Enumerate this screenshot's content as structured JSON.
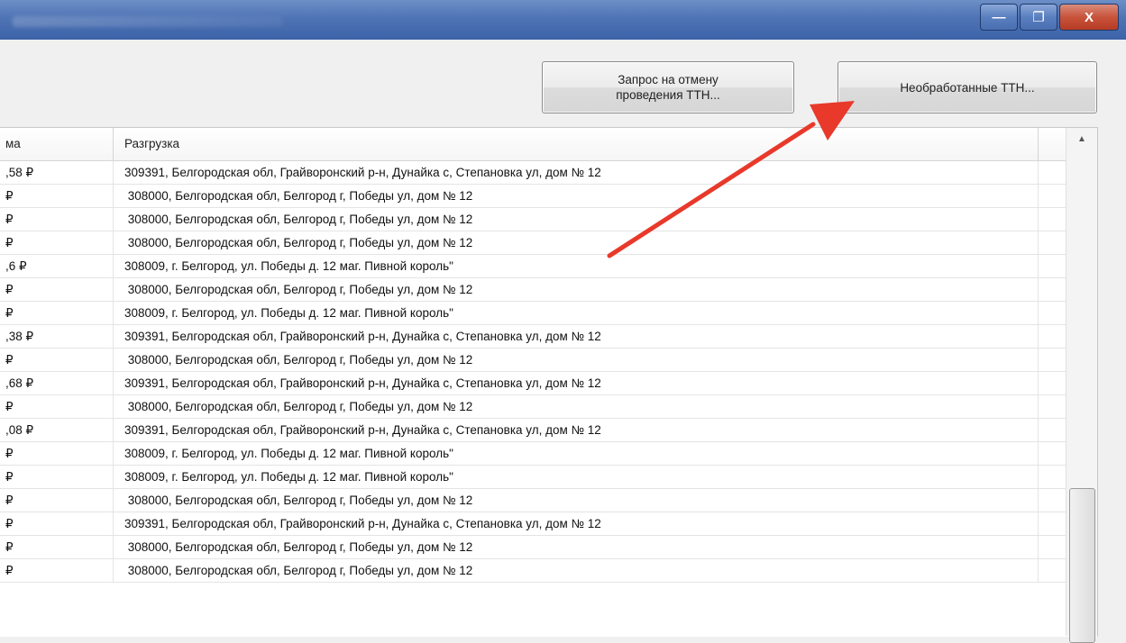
{
  "window": {
    "minimize_glyph": "—",
    "restore_glyph": "❐",
    "close_glyph": "X"
  },
  "toolbar": {
    "cancel_request_line1": "Запрос на отмену",
    "cancel_request_line2": "проведения ТТН...",
    "unprocessed_label": "Необработанные ТТН..."
  },
  "table": {
    "columns": [
      "ма",
      "Разгрузка"
    ],
    "rows": [
      {
        "sum": ",58 ₽",
        "address": "309391, Белгородская обл, Грайворонский р-н, Дунайка с, Степановка ул, дом № 12"
      },
      {
        "sum": " ₽",
        "address": " 308000, Белгородская обл, Белгород г, Победы ул, дом № 12"
      },
      {
        "sum": " ₽",
        "address": " 308000, Белгородская обл, Белгород г, Победы ул, дом № 12"
      },
      {
        "sum": " ₽",
        "address": " 308000, Белгородская обл, Белгород г, Победы ул, дом № 12"
      },
      {
        "sum": ",6 ₽",
        "address": "308009, г. Белгород, ул. Победы д. 12 маг. Пивной король\""
      },
      {
        "sum": " ₽",
        "address": " 308000, Белгородская обл, Белгород г, Победы ул, дом № 12"
      },
      {
        "sum": " ₽",
        "address": "308009, г. Белгород, ул. Победы д. 12 маг. Пивной король\""
      },
      {
        "sum": ",38 ₽",
        "address": "309391, Белгородская обл, Грайворонский р-н, Дунайка с, Степановка ул, дом № 12"
      },
      {
        "sum": " ₽",
        "address": " 308000, Белгородская обл, Белгород г, Победы ул, дом № 12"
      },
      {
        "sum": ",68 ₽",
        "address": "309391, Белгородская обл, Грайворонский р-н, Дунайка с, Степановка ул, дом № 12"
      },
      {
        "sum": " ₽",
        "address": " 308000, Белгородская обл, Белгород г, Победы ул, дом № 12"
      },
      {
        "sum": ",08 ₽",
        "address": "309391, Белгородская обл, Грайворонский р-н, Дунайка с, Степановка ул, дом № 12"
      },
      {
        "sum": " ₽",
        "address": "308009, г. Белгород, ул. Победы д. 12 маг. Пивной король\""
      },
      {
        "sum": " ₽",
        "address": "308009, г. Белгород, ул. Победы д. 12 маг. Пивной король\""
      },
      {
        "sum": " ₽",
        "address": " 308000, Белгородская обл, Белгород г, Победы ул, дом № 12"
      },
      {
        "sum": " ₽",
        "address": "309391, Белгородская обл, Грайворонский р-н, Дунайка с, Степановка ул, дом № 12"
      },
      {
        "sum": " ₽",
        "address": " 308000, Белгородская обл, Белгород г, Победы ул, дом № 12"
      },
      {
        "sum": " ₽",
        "address": " 308000, Белгородская обл, Белгород г, Победы ул, дом № 12"
      }
    ]
  },
  "scrollbar": {
    "up_glyph": "▲"
  },
  "annotation": {
    "arrow_color": "#e8392a"
  }
}
